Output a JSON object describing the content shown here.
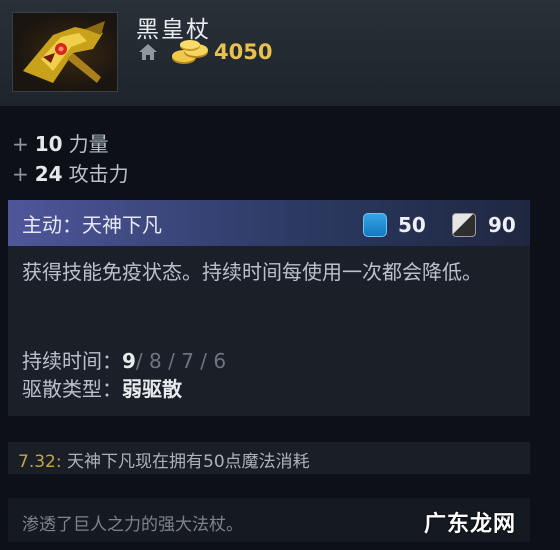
{
  "item": {
    "name": "黑皇杖",
    "icon": "black-king-bar-icon",
    "cost": "4050"
  },
  "attributes": [
    {
      "plus": "+",
      "value": "10",
      "label": "力量"
    },
    {
      "plus": "+",
      "value": "24",
      "label": "攻击力"
    }
  ],
  "ability": {
    "title": "主动：天神下凡",
    "mana_cost": "50",
    "cooldown": "90",
    "description": "获得技能免疫状态。持续时间每使用一次都会降低。",
    "duration_label": "持续时间：",
    "duration_current": "9",
    "duration_rest": "/ 8 / 7 / 6",
    "dispel_label": "驱散类型：",
    "dispel_value": "弱驱散"
  },
  "patch_note": {
    "version": "7.32:",
    "text": " 天神下凡现在拥有50点魔法消耗"
  },
  "lore": "渗透了巨人之力的强大法杖。",
  "watermark": "广东龙网",
  "colors": {
    "gold": "#e8c14e",
    "mana": "#1e8fd8",
    "ability_header": "#4f569a"
  }
}
